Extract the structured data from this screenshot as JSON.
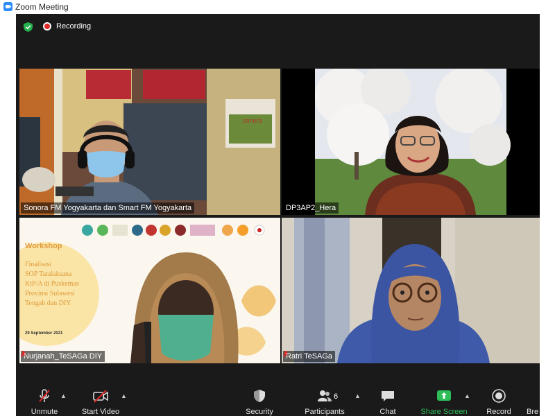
{
  "window": {
    "title": "Zoom Meeting"
  },
  "topbar": {
    "recording_label": "Recording"
  },
  "participants": [
    {
      "name": "Sonora FM Yogyakarta dan Smart FM Yogyakarta",
      "muted": false,
      "active_speaker": true
    },
    {
      "name": "DP3AP2_Hera",
      "muted": false,
      "active_speaker": false
    },
    {
      "name": "Nurjanah_TeSAGa DIY",
      "muted": true,
      "active_speaker": false
    },
    {
      "name": "Ratri TeSAGa",
      "muted": true,
      "active_speaker": false
    }
  ],
  "slide": {
    "heading": "Workshop",
    "body_lines": [
      "Finalisasi",
      "SOP Tatalaksana",
      "KtP/A di Puskemas",
      "Provinsi Sulawesi",
      "Tengah dan DIY"
    ],
    "date": "29 September 2021",
    "sign_text": "sonora"
  },
  "toolbar": {
    "unmute": "Unmute",
    "start_video": "Start Video",
    "security": "Security",
    "participants": "Participants",
    "participants_count": "6",
    "chat": "Chat",
    "share_screen": "Share Screen",
    "record": "Record",
    "breakout": "Bre"
  },
  "colors": {
    "active_outline": "#b6dc36",
    "share_green": "#2ebd59",
    "recording_red": "#e02828",
    "shield_green": "#23b14d"
  }
}
